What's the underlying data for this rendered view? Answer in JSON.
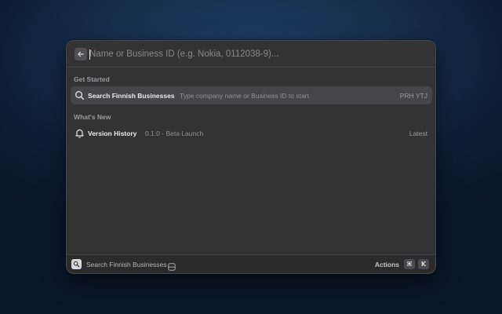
{
  "search": {
    "placeholder": "Name or Business ID (e.g. Nokia, 0112038-9)...",
    "value": ""
  },
  "sections": [
    {
      "title": "Get Started",
      "items": [
        {
          "icon": "search-icon",
          "title": "Search Finnish Businesses",
          "subtitle": "Type company name or Business ID to start",
          "accessory": "PRH YTJ",
          "selected": true
        }
      ]
    },
    {
      "title": "What's New",
      "items": [
        {
          "icon": "bell-icon",
          "title": "Version History",
          "subtitle": "0.1.0 - Beta Launch",
          "accessory": "Latest",
          "selected": false
        }
      ]
    }
  ],
  "footer": {
    "app_name": "Search Finnish Businesses",
    "actions_label": "Actions",
    "shortcut_keys": [
      "⌘",
      "K"
    ]
  },
  "colors": {
    "window_bg": "#333334",
    "selected_row": "#464648",
    "footer_bg": "#2b2b2c"
  }
}
